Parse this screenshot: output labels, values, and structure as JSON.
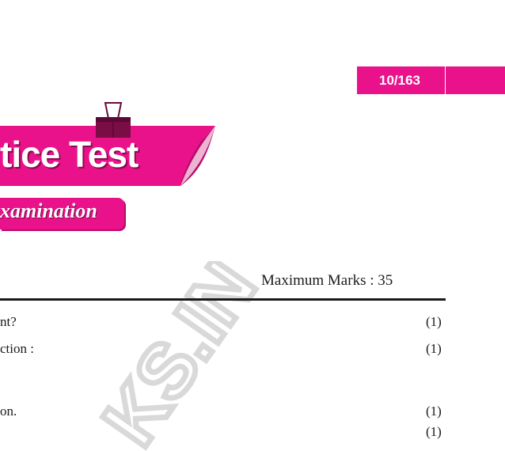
{
  "header": {
    "page_indicator": "10/163",
    "title": "tice Test",
    "subtitle": "xamination"
  },
  "paper": {
    "max_marks_label": "Maximum Marks : 35"
  },
  "questions": [
    {
      "text": "nt?",
      "marks": "(1)"
    },
    {
      "text": "ction :",
      "marks": "(1)"
    },
    {
      "text": "on.",
      "marks": "(1)"
    },
    {
      "text": "",
      "marks": "(1)"
    }
  ],
  "watermark": {
    "text": "KS.IN",
    "color": "#d9d9d9"
  },
  "colors": {
    "accent": "#e9128a",
    "accent_dark": "#8a0a50"
  }
}
